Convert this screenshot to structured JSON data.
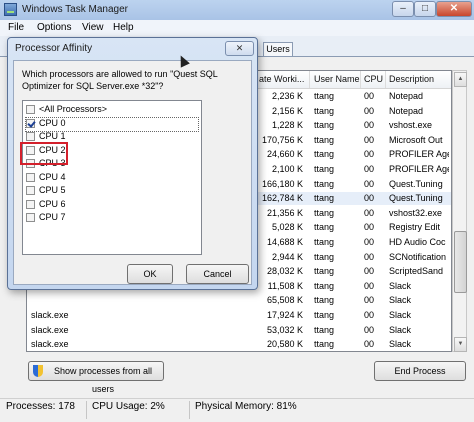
{
  "window": {
    "title": "Windows Task Manager",
    "minimize": "–",
    "maximize": "□",
    "close": "✕"
  },
  "menu": [
    "File",
    "Options",
    "View",
    "Help"
  ],
  "tabs": {
    "users": "Users"
  },
  "table": {
    "columns": [
      "Memory (Private Worki...",
      "User Name",
      "CPU",
      "Description"
    ],
    "visible_header": [
      "ate Worki...",
      "User Name",
      "CPU",
      "Description"
    ],
    "rows": [
      {
        "name": "",
        "mem": "2,236 K",
        "user": "ttang",
        "cpu": "00",
        "desc": "Notepad"
      },
      {
        "name": "",
        "mem": "2,156 K",
        "user": "ttang",
        "cpu": "00",
        "desc": "Notepad"
      },
      {
        "name": "",
        "mem": "1,228 K",
        "user": "ttang",
        "cpu": "00",
        "desc": "vshost.exe"
      },
      {
        "name": "",
        "mem": "170,756 K",
        "user": "ttang",
        "cpu": "00",
        "desc": "Microsoft Out"
      },
      {
        "name": "",
        "mem": "24,660 K",
        "user": "ttang",
        "cpu": "00",
        "desc": "PROFILER Age"
      },
      {
        "name": "",
        "mem": "2,100 K",
        "user": "ttang",
        "cpu": "00",
        "desc": "PROFILER Age"
      },
      {
        "name": "",
        "mem": "166,180 K",
        "user": "ttang",
        "cpu": "00",
        "desc": "Quest.Tuning"
      },
      {
        "name": "",
        "mem": "162,784 K",
        "user": "ttang",
        "cpu": "00",
        "desc": "Quest.Tuning"
      },
      {
        "name": "",
        "mem": "21,356 K",
        "user": "ttang",
        "cpu": "00",
        "desc": "vshost32.exe"
      },
      {
        "name": "",
        "mem": "5,028 K",
        "user": "ttang",
        "cpu": "00",
        "desc": "Registry Edit"
      },
      {
        "name": "",
        "mem": "14,688 K",
        "user": "ttang",
        "cpu": "00",
        "desc": "HD Audio Coc"
      },
      {
        "name": "",
        "mem": "2,944 K",
        "user": "ttang",
        "cpu": "00",
        "desc": "SCNotification"
      },
      {
        "name": "",
        "mem": "28,032 K",
        "user": "ttang",
        "cpu": "00",
        "desc": "ScriptedSand"
      },
      {
        "name": "",
        "mem": "11,508 K",
        "user": "ttang",
        "cpu": "00",
        "desc": "Slack"
      },
      {
        "name": "",
        "mem": "65,508 K",
        "user": "ttang",
        "cpu": "00",
        "desc": "Slack"
      },
      {
        "name": "slack.exe",
        "mem": "17,924 K",
        "user": "ttang",
        "cpu": "00",
        "desc": "Slack"
      },
      {
        "name": "slack.exe",
        "mem": "53,032 K",
        "user": "ttang",
        "cpu": "00",
        "desc": "Slack"
      },
      {
        "name": "slack.exe",
        "mem": "20,580 K",
        "user": "ttang",
        "cpu": "00",
        "desc": "Slack"
      }
    ],
    "selected_row": 7
  },
  "buttons": {
    "show_all": "Show processes from all users",
    "end_process": "End Process"
  },
  "status": {
    "processes": "Processes: 178",
    "cpu_usage": "CPU Usage: 2%",
    "physical_memory": "Physical Memory: 81%"
  },
  "dialog": {
    "title": "Processor Affinity",
    "close": "✕",
    "prompt": "Which processors are allowed to run \"Quest SQL Optimizer for SQL Server.exe *32\"?",
    "items": [
      {
        "label": "<All Processors>",
        "checked": false
      },
      {
        "label": "CPU 0",
        "checked": true
      },
      {
        "label": "CPU 1",
        "checked": false
      },
      {
        "label": "CPU 2",
        "checked": false
      },
      {
        "label": "CPU 3",
        "checked": false
      },
      {
        "label": "CPU 4",
        "checked": false
      },
      {
        "label": "CPU 5",
        "checked": false
      },
      {
        "label": "CPU 6",
        "checked": false
      },
      {
        "label": "CPU 7",
        "checked": false
      }
    ],
    "ok": "OK",
    "cancel": "Cancel"
  },
  "colors": {
    "highlight": "#d4202c",
    "title_gradient_top": "#bcd3ef"
  }
}
